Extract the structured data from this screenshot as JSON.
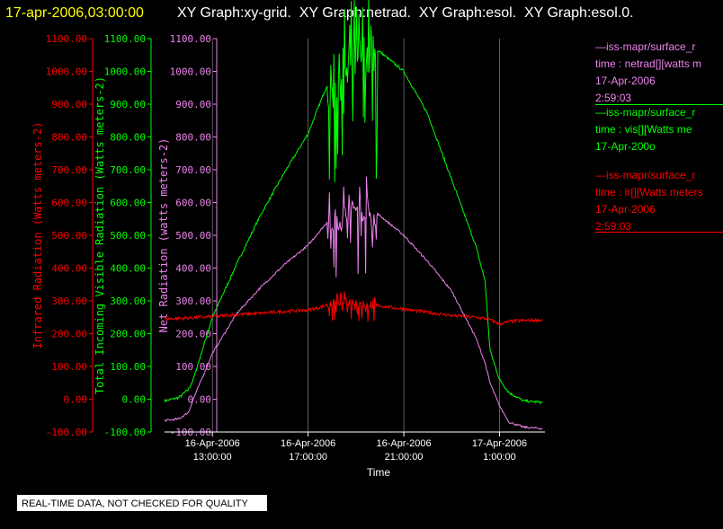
{
  "header": {
    "datetime": "17-apr-2006,03:00:00",
    "graphs": "XY Graph:xy-grid.  XY Graph:netrad.  XY Graph:esol.  XY Graph:esol.0."
  },
  "colors": {
    "background": "#000000",
    "header_datetime": "#ffff00",
    "header_text": "#ffffff",
    "infrared": "#ff0000",
    "visible": "#00ff00",
    "net": "#ee82ee",
    "grid": "#ffffff"
  },
  "legend": [
    {
      "color": "#ee82ee",
      "lines": [
        "—iss-mapr/surface_r",
        "time : netrad[][watts m",
        "17-Apr-2006",
        "2:59:03"
      ]
    },
    {
      "color": "#00ff00",
      "lines": [
        "—iss-mapr/surface_r",
        "time : vis[][Watts me",
        "17-Apr-200o"
      ]
    },
    {
      "color": "#ff0000",
      "lines": [
        "—iss-mapr/surface_r",
        "time : ir[][Watts meters",
        "17-Apr-2006",
        "2:59:03"
      ]
    }
  ],
  "quality_note": "REAL-TIME DATA, NOT CHECKED FOR QUALITY",
  "chart_data": {
    "type": "line",
    "xlabel": "Time",
    "x_ticks": [
      {
        "t": 13,
        "line1": "16-Apr-2006",
        "line2": "13:00:00"
      },
      {
        "t": 17,
        "line1": "16-Apr-2006",
        "line2": "17:00:00"
      },
      {
        "t": 21,
        "line1": "16-Apr-2006",
        "line2": "21:00:00"
      },
      {
        "t": 25,
        "line1": "17-Apr-2006",
        "line2": "1:00:00"
      }
    ],
    "xlim": [
      11.0,
      26.9
    ],
    "ylim": [
      -100,
      1100
    ],
    "y_ticks": [
      -100,
      0,
      100,
      200,
      300,
      400,
      500,
      600,
      700,
      800,
      900,
      1000,
      1100
    ],
    "y_tick_labels": [
      "-100.00",
      "0.00",
      "100.00",
      "200.00",
      "300.00",
      "400.00",
      "500.00",
      "600.00",
      "700.00",
      "800.00",
      "900.00",
      "1000.00",
      "1100.00"
    ],
    "axes": [
      {
        "name": "infrared",
        "label": "Infrared Radiation (Watts meters-2)",
        "color": "#ff0000"
      },
      {
        "name": "visible",
        "label": "Total Incoming Visible Radiation (Watts meters-2)",
        "color": "#00ff00"
      },
      {
        "name": "net",
        "label": "Net Radiation (watts meters-2)",
        "color": "#ee82ee"
      }
    ],
    "series": [
      {
        "name": "vis",
        "color": "#00ff00",
        "x": [
          11.0,
          11.6,
          12.0,
          12.2,
          13.0,
          14.0,
          15.0,
          16.0,
          17.0,
          17.8,
          18.4,
          18.8,
          19.4,
          20.0,
          21.0,
          22.0,
          23.0,
          24.0,
          24.4,
          24.6,
          25.0,
          25.4,
          26.0,
          26.8
        ],
        "y": [
          -5,
          5,
          30,
          60,
          250,
          410,
          560,
          690,
          810,
          960,
          1020,
          1060,
          1080,
          1060,
          1000,
          870,
          670,
          470,
          360,
          150,
          60,
          20,
          -5,
          -10
        ]
      },
      {
        "name": "netrad",
        "color": "#ee82ee",
        "x": [
          11.0,
          11.6,
          12.0,
          12.2,
          13.0,
          14.0,
          15.0,
          16.0,
          17.0,
          17.8,
          18.4,
          19.0,
          19.4,
          20.0,
          21.0,
          22.0,
          23.0,
          24.0,
          24.4,
          24.6,
          25.0,
          25.4,
          26.0,
          26.8
        ],
        "y": [
          -65,
          -60,
          -40,
          0,
          140,
          260,
          340,
          410,
          470,
          540,
          575,
          600,
          595,
          560,
          500,
          420,
          330,
          190,
          110,
          50,
          -20,
          -70,
          -85,
          -90
        ]
      },
      {
        "name": "ir",
        "color": "#ff0000",
        "x": [
          11.0,
          12.0,
          13.0,
          14.0,
          15.0,
          16.0,
          17.0,
          17.5,
          18.0,
          18.6,
          19.0,
          20.0,
          21.0,
          22.0,
          23.0,
          24.0,
          24.5,
          25.0,
          25.5,
          26.0,
          26.8
        ],
        "y": [
          245,
          248,
          252,
          258,
          262,
          268,
          272,
          280,
          295,
          305,
          300,
          285,
          275,
          265,
          255,
          250,
          245,
          230,
          238,
          240,
          242
        ]
      }
    ],
    "noise_interval": [
      17.8,
      19.9
    ]
  }
}
